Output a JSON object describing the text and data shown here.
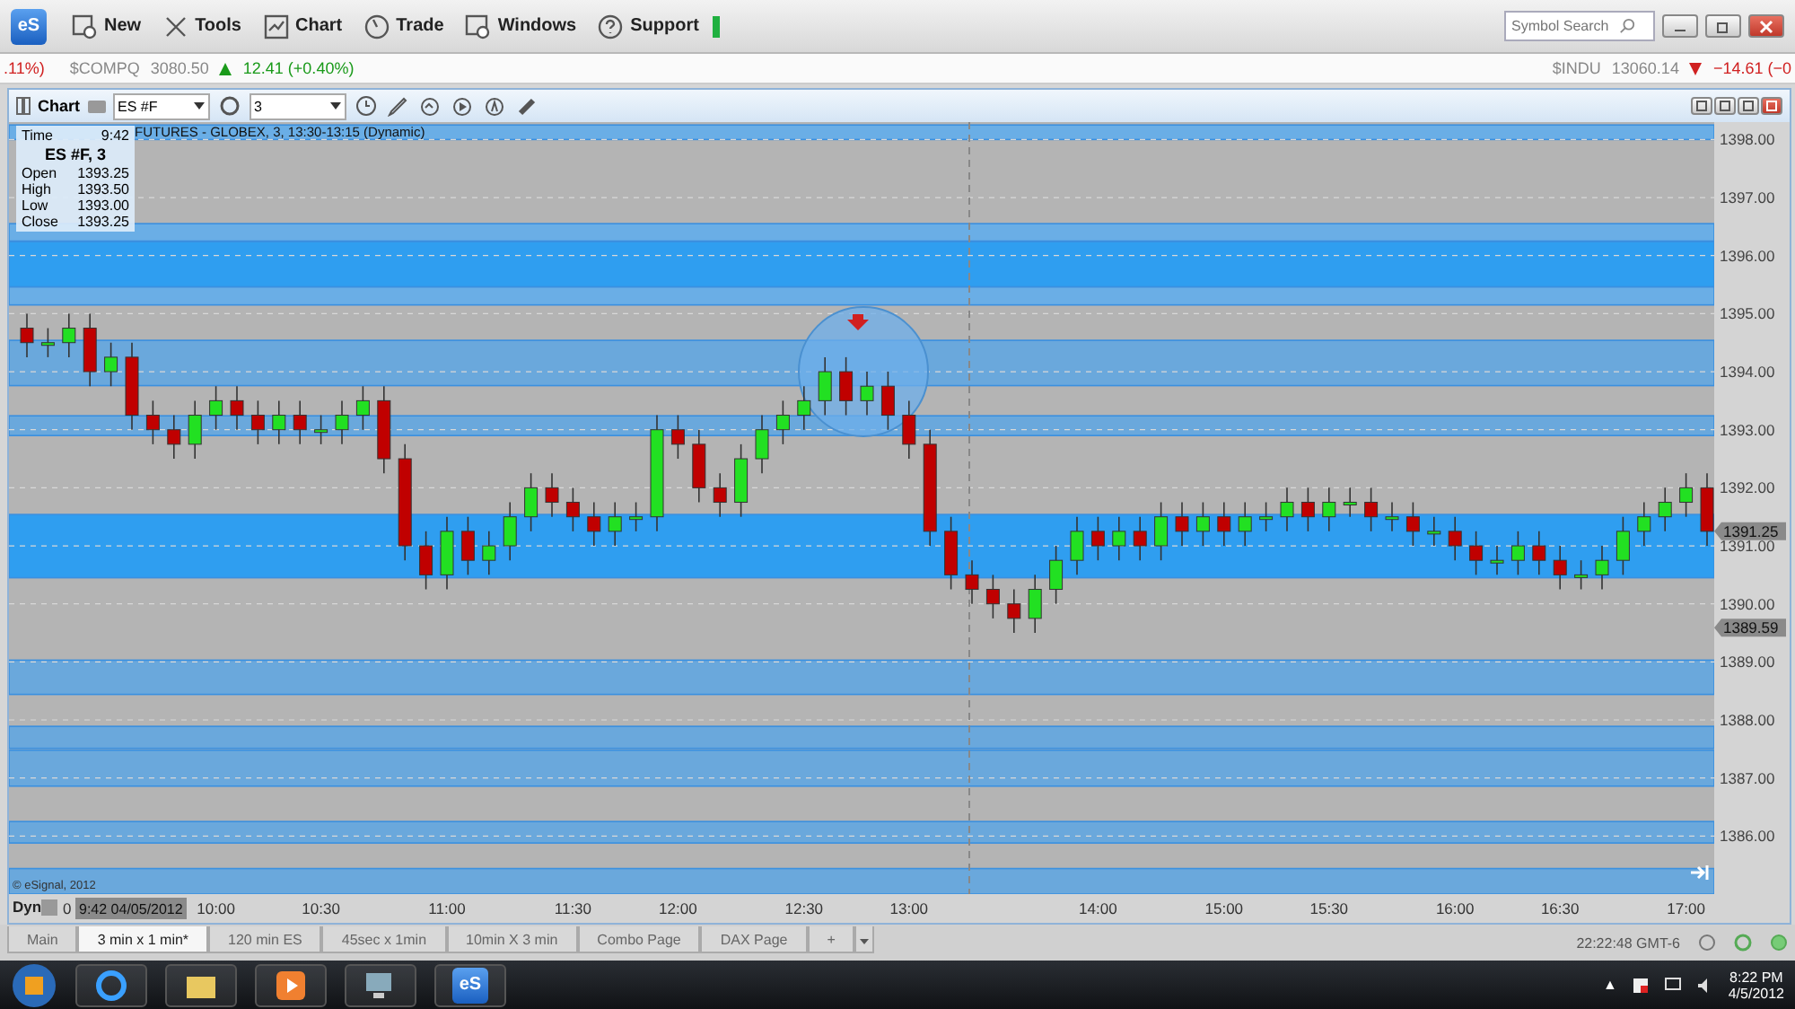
{
  "toolbar": {
    "logo": "eS",
    "buttons": [
      {
        "kind": "new",
        "label": "New"
      },
      {
        "kind": "tools",
        "label": "Tools"
      },
      {
        "kind": "chart",
        "label": "Chart"
      },
      {
        "kind": "trade",
        "label": "Trade"
      },
      {
        "kind": "windows",
        "label": "Windows"
      },
      {
        "kind": "support",
        "label": "Support"
      }
    ],
    "search": {
      "placeholder": "Symbol Search"
    }
  },
  "ticker": [
    {
      "change": ".11%)",
      "rising": false
    },
    {
      "symbol": "$COMPQ",
      "price": "3080.50",
      "change": "12.41 (+0.40%)",
      "rising": true
    },
    {
      "symbol": "$INDU",
      "price": "13060.14",
      "change": "−14.61 (−0",
      "rising": false
    }
  ],
  "chart_window": {
    "title": "Chart",
    "symbol": "ES #F",
    "interval": "3",
    "study_title": "FUTURES - GLOBEX, 3, 13:30-13:15 (Dynamic)",
    "copyright": "© eSignal, 2012",
    "mode": "Dyn",
    "cursor_time": "9:42 04/05/2012",
    "cut_label": "0",
    "data_window": {
      "time_label": "Time",
      "time": "9:42",
      "heading": "ES #F, 3",
      "rows": [
        {
          "label": "Open",
          "value": "1393.25"
        },
        {
          "label": "High",
          "value": "1393.50"
        },
        {
          "label": "Low",
          "value": "1393.00"
        },
        {
          "label": "Close",
          "value": "1393.25"
        }
      ]
    },
    "chart_data": {
      "type": "candlestick",
      "ylim": [
        1385.0,
        1398.3
      ],
      "grid": true,
      "yticks": [
        {
          "value": 1398,
          "label": "1398.00"
        },
        {
          "value": 1397,
          "label": "1397.00"
        },
        {
          "value": 1396,
          "label": "1396.00"
        },
        {
          "value": 1395,
          "label": "1395.00"
        },
        {
          "value": 1394,
          "label": "1394.00"
        },
        {
          "value": 1393,
          "label": "1393.00"
        },
        {
          "value": 1392,
          "label": "1392.00"
        },
        {
          "value": 1391,
          "label": "1391.00"
        },
        {
          "value": 1390,
          "label": "1390.00"
        },
        {
          "value": 1389,
          "label": "1389.00"
        },
        {
          "value": 1388,
          "label": "1388.00"
        },
        {
          "value": 1387,
          "label": "1387.00"
        },
        {
          "value": 1386,
          "label": "1386.00"
        }
      ],
      "categories": [
        null,
        null,
        null,
        null,
        null,
        null,
        null,
        null,
        null,
        "10:00",
        null,
        null,
        null,
        null,
        "10:30",
        null,
        null,
        null,
        null,
        null,
        "11:00",
        null,
        null,
        null,
        null,
        null,
        "11:30",
        null,
        null,
        null,
        null,
        "12:00",
        null,
        null,
        null,
        null,
        null,
        "12:30",
        null,
        null,
        null,
        null,
        "13:00",
        null,
        null,
        null,
        null,
        null,
        null,
        null,
        null,
        "14:00",
        null,
        null,
        null,
        null,
        null,
        "15:00",
        null,
        null,
        null,
        null,
        "15:30",
        null,
        null,
        null,
        null,
        null,
        "16:00",
        null,
        null,
        null,
        null,
        "16:30",
        null,
        null,
        null,
        null,
        null,
        "17:00",
        null
      ],
      "ohlc": [
        [
          1394.75,
          1395.0,
          1394.25,
          1394.5
        ],
        [
          1394.5,
          1394.75,
          1394.25,
          1394.5
        ],
        [
          1394.5,
          1395.0,
          1394.25,
          1394.75
        ],
        [
          1394.75,
          1395.0,
          1393.75,
          1394.0
        ],
        [
          1394.0,
          1394.5,
          1393.75,
          1394.25
        ],
        [
          1394.25,
          1394.5,
          1393.0,
          1393.25
        ],
        [
          1393.25,
          1393.5,
          1392.75,
          1393.0
        ],
        [
          1393.0,
          1393.25,
          1392.5,
          1392.75
        ],
        [
          1392.75,
          1393.5,
          1392.5,
          1393.25
        ],
        [
          1393.25,
          1393.75,
          1393.0,
          1393.5
        ],
        [
          1393.5,
          1393.75,
          1393.0,
          1393.25
        ],
        [
          1393.25,
          1393.5,
          1392.75,
          1393.0
        ],
        [
          1393.0,
          1393.5,
          1392.75,
          1393.25
        ],
        [
          1393.25,
          1393.5,
          1392.75,
          1393.0
        ],
        [
          1393.0,
          1393.25,
          1392.75,
          1393.0
        ],
        [
          1393.0,
          1393.5,
          1392.75,
          1393.25
        ],
        [
          1393.25,
          1393.75,
          1393.0,
          1393.5
        ],
        [
          1393.5,
          1393.75,
          1392.25,
          1392.5
        ],
        [
          1392.5,
          1392.75,
          1390.75,
          1391.0
        ],
        [
          1391.0,
          1391.25,
          1390.25,
          1390.5
        ],
        [
          1390.5,
          1391.5,
          1390.25,
          1391.25
        ],
        [
          1391.25,
          1391.5,
          1390.5,
          1390.75
        ],
        [
          1390.75,
          1391.25,
          1390.5,
          1391.0
        ],
        [
          1391.0,
          1391.75,
          1390.75,
          1391.5
        ],
        [
          1391.5,
          1392.25,
          1391.25,
          1392.0
        ],
        [
          1392.0,
          1392.25,
          1391.5,
          1391.75
        ],
        [
          1391.75,
          1392.0,
          1391.25,
          1391.5
        ],
        [
          1391.5,
          1391.75,
          1391.0,
          1391.25
        ],
        [
          1391.25,
          1391.75,
          1391.0,
          1391.5
        ],
        [
          1391.5,
          1391.75,
          1391.25,
          1391.5
        ],
        [
          1391.5,
          1393.25,
          1391.25,
          1393.0
        ],
        [
          1393.0,
          1393.25,
          1392.5,
          1392.75
        ],
        [
          1392.75,
          1393.0,
          1391.75,
          1392.0
        ],
        [
          1392.0,
          1392.25,
          1391.5,
          1391.75
        ],
        [
          1391.75,
          1392.75,
          1391.5,
          1392.5
        ],
        [
          1392.5,
          1393.25,
          1392.25,
          1393.0
        ],
        [
          1393.0,
          1393.5,
          1392.75,
          1393.25
        ],
        [
          1393.25,
          1393.75,
          1393.0,
          1393.5
        ],
        [
          1393.5,
          1394.25,
          1393.25,
          1394.0
        ],
        [
          1394.0,
          1394.25,
          1393.25,
          1393.5
        ],
        [
          1393.5,
          1394.0,
          1393.25,
          1393.75
        ],
        [
          1393.75,
          1394.0,
          1393.0,
          1393.25
        ],
        [
          1393.25,
          1393.5,
          1392.5,
          1392.75
        ],
        [
          1392.75,
          1393.0,
          1391.0,
          1391.25
        ],
        [
          1391.25,
          1391.5,
          1390.25,
          1390.5
        ],
        [
          1390.5,
          1390.75,
          1390.0,
          1390.25
        ],
        [
          1390.25,
          1390.5,
          1389.75,
          1390.0
        ],
        [
          1390.0,
          1390.25,
          1389.5,
          1389.75
        ],
        [
          1389.75,
          1390.5,
          1389.5,
          1390.25
        ],
        [
          1390.25,
          1391.0,
          1390.0,
          1390.75
        ],
        [
          1390.75,
          1391.5,
          1390.5,
          1391.25
        ],
        [
          1391.25,
          1391.5,
          1390.75,
          1391.0
        ],
        [
          1391.0,
          1391.5,
          1390.75,
          1391.25
        ],
        [
          1391.25,
          1391.5,
          1390.75,
          1391.0
        ],
        [
          1391.0,
          1391.75,
          1390.75,
          1391.5
        ],
        [
          1391.5,
          1391.75,
          1391.0,
          1391.25
        ],
        [
          1391.25,
          1391.75,
          1391.0,
          1391.5
        ],
        [
          1391.5,
          1391.75,
          1391.0,
          1391.25
        ],
        [
          1391.25,
          1391.75,
          1391.0,
          1391.5
        ],
        [
          1391.5,
          1391.75,
          1391.25,
          1391.5
        ],
        [
          1391.5,
          1392.0,
          1391.25,
          1391.75
        ],
        [
          1391.75,
          1392.0,
          1391.25,
          1391.5
        ],
        [
          1391.5,
          1392.0,
          1391.25,
          1391.75
        ],
        [
          1391.75,
          1392.0,
          1391.5,
          1391.75
        ],
        [
          1391.75,
          1392.0,
          1391.25,
          1391.5
        ],
        [
          1391.5,
          1391.75,
          1391.25,
          1391.5
        ],
        [
          1391.5,
          1391.75,
          1391.0,
          1391.25
        ],
        [
          1391.25,
          1391.5,
          1391.0,
          1391.25
        ],
        [
          1391.25,
          1391.5,
          1390.75,
          1391.0
        ],
        [
          1391.0,
          1391.25,
          1390.5,
          1390.75
        ],
        [
          1390.75,
          1391.0,
          1390.5,
          1390.75
        ],
        [
          1390.75,
          1391.25,
          1390.5,
          1391.0
        ],
        [
          1391.0,
          1391.25,
          1390.5,
          1390.75
        ],
        [
          1390.75,
          1391.0,
          1390.25,
          1390.5
        ],
        [
          1390.5,
          1390.75,
          1390.25,
          1390.5
        ],
        [
          1390.5,
          1391.0,
          1390.25,
          1390.75
        ],
        [
          1390.75,
          1391.5,
          1390.5,
          1391.25
        ],
        [
          1391.25,
          1391.75,
          1391.0,
          1391.5
        ],
        [
          1391.5,
          1392.0,
          1391.25,
          1391.75
        ],
        [
          1391.75,
          1392.25,
          1391.5,
          1392.0
        ],
        [
          1392.0,
          1392.25,
          1391.0,
          1391.25
        ]
      ],
      "annotations": [
        "1391.25",
        "1389.59"
      ]
    }
  },
  "page_tabs": [
    {
      "label": "Main",
      "selected": false
    },
    {
      "label": "3 min x 1 min*",
      "selected": true
    },
    {
      "label": "120 min ES",
      "selected": false
    },
    {
      "label": "45sec x 1min",
      "selected": false
    },
    {
      "label": "10min X 3 min",
      "selected": false
    },
    {
      "label": "Combo Page",
      "selected": false
    },
    {
      "label": "DAX Page",
      "selected": false
    }
  ],
  "add_tab": "+",
  "status": {
    "clock": "22:22:48 GMT-6"
  },
  "taskbar": {
    "apps": [
      {
        "kind": "browser"
      },
      {
        "kind": "folder"
      },
      {
        "kind": "media"
      },
      {
        "kind": "computer"
      },
      {
        "kind": "esignal",
        "label": "eS"
      }
    ],
    "tray_arrow": "▲",
    "time": "8:22 PM",
    "date": "4/5/2012"
  }
}
